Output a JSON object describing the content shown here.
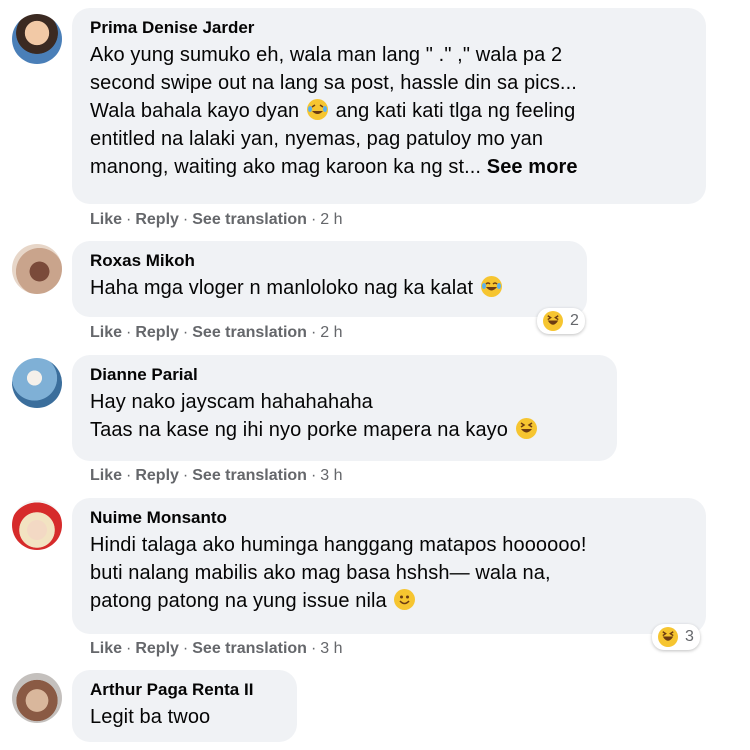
{
  "comments": [
    {
      "author": "Prima Denise Jarder",
      "lines": [
        "Ako yung sumuko eh, wala man lang \" .\" ,\" wala pa 2",
        "second swipe out na lang sa post, hassle din sa pics...",
        "Wala bahala kayo dyan",
        "ang kati kati tlga ng feeling",
        "entitled na lalaki yan, nyemas, pag patuloy mo yan",
        "manong, waiting ako mag karoon ka ng st...",
        "See more"
      ],
      "actions": {
        "like": "Like",
        "reply": "Reply",
        "translate": "See translation",
        "time": "2 h"
      }
    },
    {
      "author": "Roxas Mikoh",
      "lines": [
        "Haha mga vloger n manloloko nag ka kalat"
      ],
      "reaction_count": "2",
      "actions": {
        "like": "Like",
        "reply": "Reply",
        "translate": "See translation",
        "time": "2 h"
      }
    },
    {
      "author": "Dianne Parial",
      "lines": [
        "Hay nako jayscam hahahahaha",
        "Taas na kase ng ihi nyo porke mapera na kayo"
      ],
      "actions": {
        "like": "Like",
        "reply": "Reply",
        "translate": "See translation",
        "time": "3 h"
      }
    },
    {
      "author": "Nuime Monsanto",
      "lines": [
        "Hindi talaga ako huminga hanggang matapos hoooooo!",
        "buti nalang mabilis ako mag basa hshsh— wala na,",
        "patong patong na yung issue nila"
      ],
      "reaction_count": "3",
      "actions": {
        "like": "Like",
        "reply": "Reply",
        "translate": "See translation",
        "time": "3 h"
      }
    },
    {
      "author": "Arthur Paga Renta II",
      "lines": [
        "Legit ba twoo"
      ]
    }
  ],
  "separator": "·",
  "colors": {
    "bubble": "#f0f2f5",
    "meta": "#65676b",
    "emoji": "#f6c530"
  }
}
